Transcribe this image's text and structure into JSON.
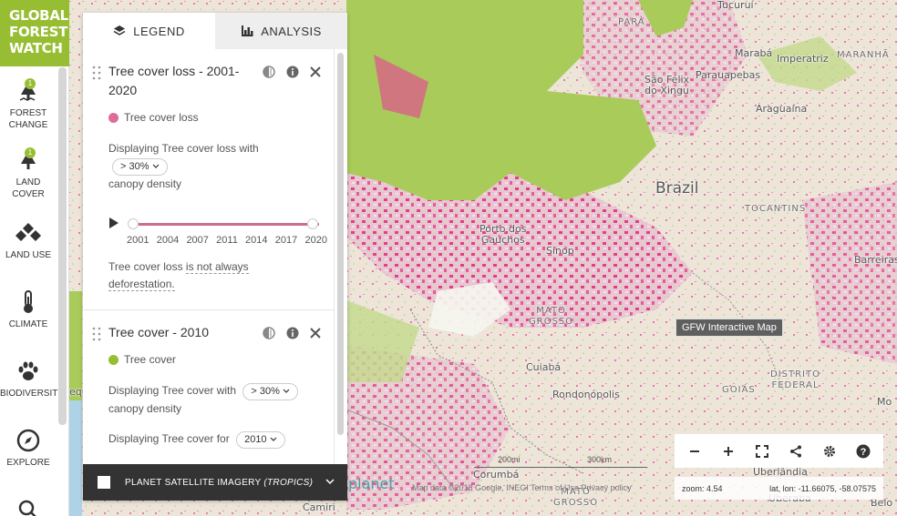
{
  "logo": {
    "line1": "GLOBAL",
    "line2": "FOREST",
    "line3": "WATCH"
  },
  "nav": {
    "items": [
      {
        "label": "FOREST\nCHANGE",
        "icon": "tree-loss-icon",
        "badge": "1"
      },
      {
        "label": "LAND\nCOVER",
        "icon": "tree-icon",
        "badge": "1"
      },
      {
        "label": "LAND USE",
        "icon": "land-use-icon"
      },
      {
        "label": "CLIMATE",
        "icon": "thermometer-icon"
      },
      {
        "label": "BIODIVERSITY",
        "icon": "paw-icon"
      },
      {
        "label": "EXPLORE",
        "icon": "compass-icon"
      }
    ]
  },
  "panel": {
    "tabs": [
      {
        "label": "LEGEND",
        "icon": "layers-icon",
        "active": true
      },
      {
        "label": "ANALYSIS",
        "icon": "bar-chart-icon",
        "active": false
      }
    ],
    "layers": [
      {
        "title": "Tree cover loss - 2001-2020",
        "swatch_color": "#dc6c9a",
        "swatch_label": "Tree cover loss",
        "desc_prefix": "Displaying Tree cover loss with",
        "threshold": "> 30%",
        "desc_suffix": "canopy density",
        "timeline_years": [
          "2001",
          "2004",
          "2007",
          "2011",
          "2014",
          "2017",
          "2020"
        ],
        "note_prefix": "Tree cover loss ",
        "note_link": "is not always deforestation."
      },
      {
        "title": "Tree cover - 2010",
        "swatch_color": "#97be32",
        "swatch_label": "Tree cover",
        "desc_prefix": "Displaying Tree cover with",
        "threshold": "> 30%",
        "desc_suffix": "canopy density",
        "year_prefix": "Displaying Tree cover for",
        "year": "2010"
      }
    ],
    "planet_label": "PLANET SATELLITE IMAGERY",
    "planet_label_em": "(TROPICS)"
  },
  "map": {
    "labels": {
      "brazil": "Brazil",
      "para": "PARÁ",
      "tucurui": "Tucuruí",
      "maraba": "Marabá",
      "imperatriz": "Imperatriz",
      "maranhao": "MARANHÃ",
      "sao_felix": "São Félix\ndo Xingu",
      "parauapebas": "Parauapebas",
      "araguaina": "Araguaína",
      "tocantins": "TOCANTINS",
      "barreiras": "Barreiras",
      "porto": "Porto dos\nGaúchos",
      "sinop": "Sinop",
      "mato_grosso": "MATO\nGROSSO",
      "cuiaba": "Cuiabá",
      "rondonopolis": "Rondonópolis",
      "distrito": "DISTRITO\nFEDERAL",
      "goias": "GOIÁS",
      "mo": "Mo",
      "corumba": "Corumbá",
      "uberlandia": "Uberlândia",
      "uberaba": "Uberaba",
      "belo": "Belo",
      "camiri": "Camiri",
      "mato_grosso_sul": "MATO\nGROSSO",
      "equ": "equ"
    },
    "tooltip": "GFW Interactive Map",
    "scale_left": "200mi",
    "scale_right": "300km",
    "attribution": "Map data ©2018 Google, INEGI   Terms of Use   Privacy policy",
    "planet_logo": "planet",
    "zoom": "zoom: 4.54",
    "latlon": "lat, lon: -11.66075, -58.07575"
  },
  "colors": {
    "brand_green": "#97be32",
    "loss_pink": "#dc6c9a",
    "cover_green": "#a8cb5a"
  }
}
